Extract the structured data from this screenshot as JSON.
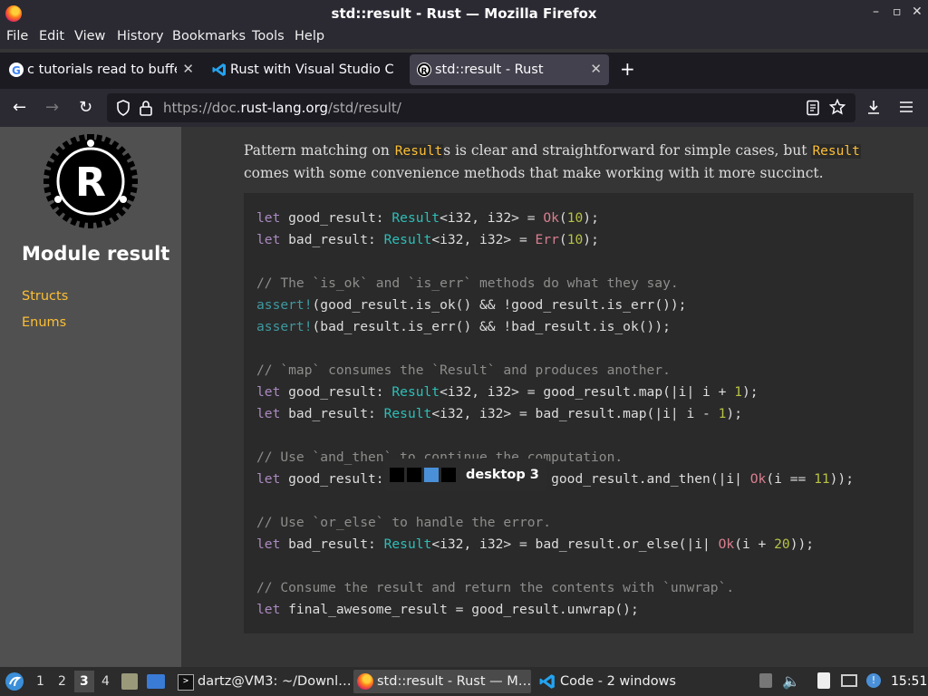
{
  "window": {
    "title": "std::result - Rust — Mozilla Firefox"
  },
  "menu": [
    "File",
    "Edit",
    "View",
    "History",
    "Bookmarks",
    "Tools",
    "Help"
  ],
  "tabs": [
    {
      "label": "c tutorials read to buffer",
      "icon": "google-icon"
    },
    {
      "label": "Rust with Visual Studio C",
      "icon": "vscode-icon"
    },
    {
      "label": "std::result - Rust",
      "icon": "rust-icon"
    }
  ],
  "url": {
    "prefix": "https://doc.",
    "domain": "rust-lang.org",
    "path": "/std/result/"
  },
  "sidebar": {
    "module_title": "Module result",
    "links": [
      "Structs",
      "Enums"
    ]
  },
  "content": {
    "para_parts": [
      "Pattern matching on ",
      "Result",
      "s is clear and straightforward for simple cases, but ",
      "Result",
      " comes with some convenience methods that make working with it more succinct."
    ]
  },
  "osd": {
    "label": "desktop 3"
  },
  "taskbar": {
    "workspaces": [
      "1",
      "2",
      "3",
      "4"
    ],
    "tasks": [
      "dartz@VM3: ~/Downl…",
      "std::result - Rust — M…",
      "Code - 2 windows"
    ],
    "clock": "15:51"
  },
  "colors": {
    "accent_link": "#fdbf35",
    "code_bg": "#2a2a2a",
    "sidebar_bg": "#505050"
  }
}
